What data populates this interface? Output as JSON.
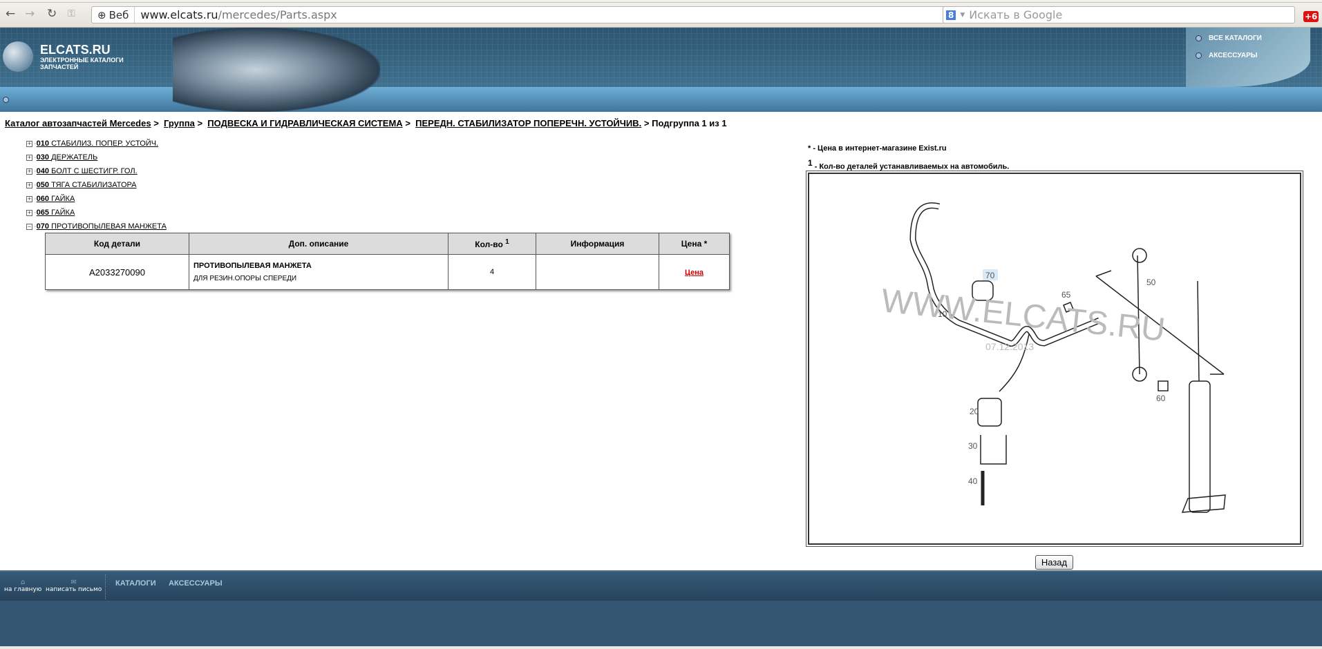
{
  "browser": {
    "site_label": "Веб",
    "url_host": "www.elcats.ru",
    "url_path": "/mercedes/Parts.aspx",
    "search_placeholder": "Искать в Google",
    "badge": "+6"
  },
  "header": {
    "logo_title": "ELCATS.RU",
    "logo_subtitle": "ЭЛЕКТРОННЫЕ КАТАЛОГИ ЗАПЧАСТЕЙ",
    "nav": [
      "ВСЕ КАТАЛОГИ",
      "АКСЕССУАРЫ"
    ]
  },
  "breadcrumb": {
    "items": [
      "Каталог автозапчастей Mercedes",
      "Группа",
      "ПОДВЕСКА И ГИДРАВЛИЧЕСКАЯ СИСТЕМА",
      "ПЕРЕДН. СТАБИЛИЗАТОР ПОПЕРЕЧН. УСТОЙЧИВ."
    ],
    "current": "Подгруппа 1 из 1",
    "sep": ">"
  },
  "tree": [
    {
      "sign": "+",
      "code": "010",
      "name": "СТАБИЛИЗ. ПОПЕР. УСТОЙЧ."
    },
    {
      "sign": "+",
      "code": "030",
      "name": "ДЕРЖАТЕЛЬ"
    },
    {
      "sign": "+",
      "code": "040",
      "name": "БОЛТ С ШЕСТИГР. ГОЛ."
    },
    {
      "sign": "+",
      "code": "050",
      "name": "ТЯГА СТАБИЛИЗАТОРА"
    },
    {
      "sign": "+",
      "code": "060",
      "name": "ГАЙКА"
    },
    {
      "sign": "+",
      "code": "065",
      "name": "ГАЙКА"
    },
    {
      "sign": "−",
      "code": "070",
      "name": "ПРОТИВОПЫЛЕВАЯ МАНЖЕТА"
    }
  ],
  "table": {
    "headers": [
      "Код детали",
      "Доп. описание",
      "Кол-во",
      "Информация",
      "Цена *"
    ],
    "qty_sup": "1",
    "rows": [
      {
        "code": "A2033270090",
        "desc_title": "ПРОТИВОПЫЛЕВАЯ МАНЖЕТА",
        "desc_sub": "ДЛЯ РЕЗИН.ОПОРЫ СПЕРЕДИ",
        "qty": "4",
        "info": "",
        "price": "Цена"
      }
    ]
  },
  "notes": {
    "star_mark": "*",
    "star": " - Цена в интернет-магазине Exist.ru",
    "one_mark": "1",
    "one": " - Кол-во деталей устанавливаемых на автомобиль."
  },
  "diagram": {
    "labels": [
      "10",
      "20",
      "30",
      "40",
      "50",
      "60",
      "65",
      "70"
    ],
    "watermark": "WWW.ELCATS.RU",
    "date": "07.12.2013"
  },
  "back_label": "Назад",
  "footer": {
    "home": "на главную",
    "mail": "написать письмо",
    "links": [
      "КАТАЛОГИ",
      "АКСЕССУАРЫ"
    ]
  },
  "colors": {
    "price_link": "#cc0000",
    "header": "#3a6685",
    "footer": "#355673"
  }
}
